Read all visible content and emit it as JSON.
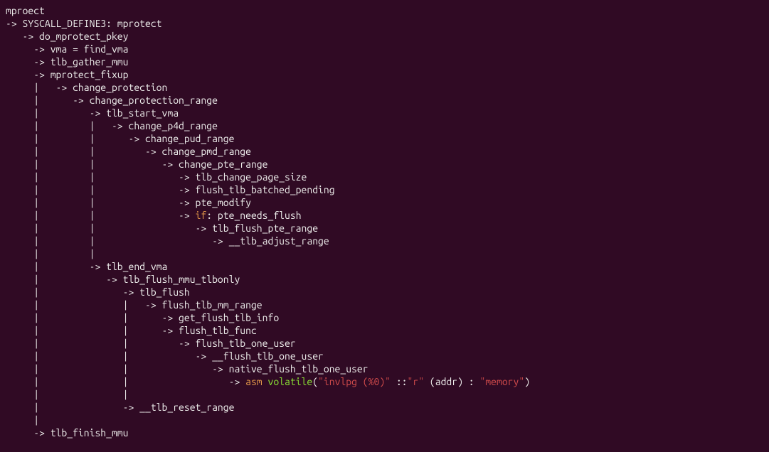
{
  "lines": [
    [
      {
        "t": "mproect"
      }
    ],
    [
      {
        "t": "-> SYSCALL_DEFINE3: mprotect"
      }
    ],
    [
      {
        "t": "   -> do_mprotect_pkey"
      }
    ],
    [
      {
        "t": "     -> vma = find_vma"
      }
    ],
    [
      {
        "t": "     -> tlb_gather_mmu"
      }
    ],
    [
      {
        "t": "     -> mprotect_fixup"
      }
    ],
    [
      {
        "t": "     |   -> change_protection"
      }
    ],
    [
      {
        "t": "     |      -> change_protection_range"
      }
    ],
    [
      {
        "t": "     |         -> tlb_start_vma"
      }
    ],
    [
      {
        "t": "     |         |   -> change_p4d_range"
      }
    ],
    [
      {
        "t": "     |         |      -> change_pud_range"
      }
    ],
    [
      {
        "t": "     |         |         -> change_pmd_range"
      }
    ],
    [
      {
        "t": "     |         |            -> change_pte_range"
      }
    ],
    [
      {
        "t": "     |         |               -> tlb_change_page_size"
      }
    ],
    [
      {
        "t": "     |         |               -> flush_tlb_batched_pending"
      }
    ],
    [
      {
        "t": "     |         |               -> pte_modify"
      }
    ],
    [
      {
        "t": "     |         |               -> "
      },
      {
        "t": "if",
        "c": "kw-or"
      },
      {
        "t": ": pte_needs_flush"
      }
    ],
    [
      {
        "t": "     |         |                  -> tlb_flush_pte_range"
      }
    ],
    [
      {
        "t": "     |         |                     -> __tlb_adjust_range"
      }
    ],
    [
      {
        "t": "     |         |"
      }
    ],
    [
      {
        "t": "     |         -> tlb_end_vma"
      }
    ],
    [
      {
        "t": "     |            -> tlb_flush_mmu_tlbonly"
      }
    ],
    [
      {
        "t": "     |               -> tlb_flush"
      }
    ],
    [
      {
        "t": "     |               |   -> flush_tlb_mm_range"
      }
    ],
    [
      {
        "t": "     |               |      -> get_flush_tlb_info"
      }
    ],
    [
      {
        "t": "     |               |      -> flush_tlb_func"
      }
    ],
    [
      {
        "t": "     |               |         -> flush_tlb_one_user"
      }
    ],
    [
      {
        "t": "     |               |            -> __flush_tlb_one_user"
      }
    ],
    [
      {
        "t": "     |               |               -> native_flush_tlb_one_user"
      }
    ],
    [
      {
        "t": "     |               |                  -> "
      },
      {
        "t": "asm",
        "c": "kw-or"
      },
      {
        "t": " "
      },
      {
        "t": "volatile",
        "c": "kw-gr"
      },
      {
        "t": "("
      },
      {
        "t": "\"invlpg (%0)\"",
        "c": "str"
      },
      {
        "t": " ::"
      },
      {
        "t": "\"r\"",
        "c": "str"
      },
      {
        "t": " (addr) : "
      },
      {
        "t": "\"memory\"",
        "c": "str"
      },
      {
        "t": ")"
      }
    ],
    [
      {
        "t": "     |               |"
      }
    ],
    [
      {
        "t": "     |               -> __tlb_reset_range"
      }
    ],
    [
      {
        "t": "     |"
      }
    ],
    [
      {
        "t": "     -> tlb_finish_mmu"
      }
    ]
  ]
}
